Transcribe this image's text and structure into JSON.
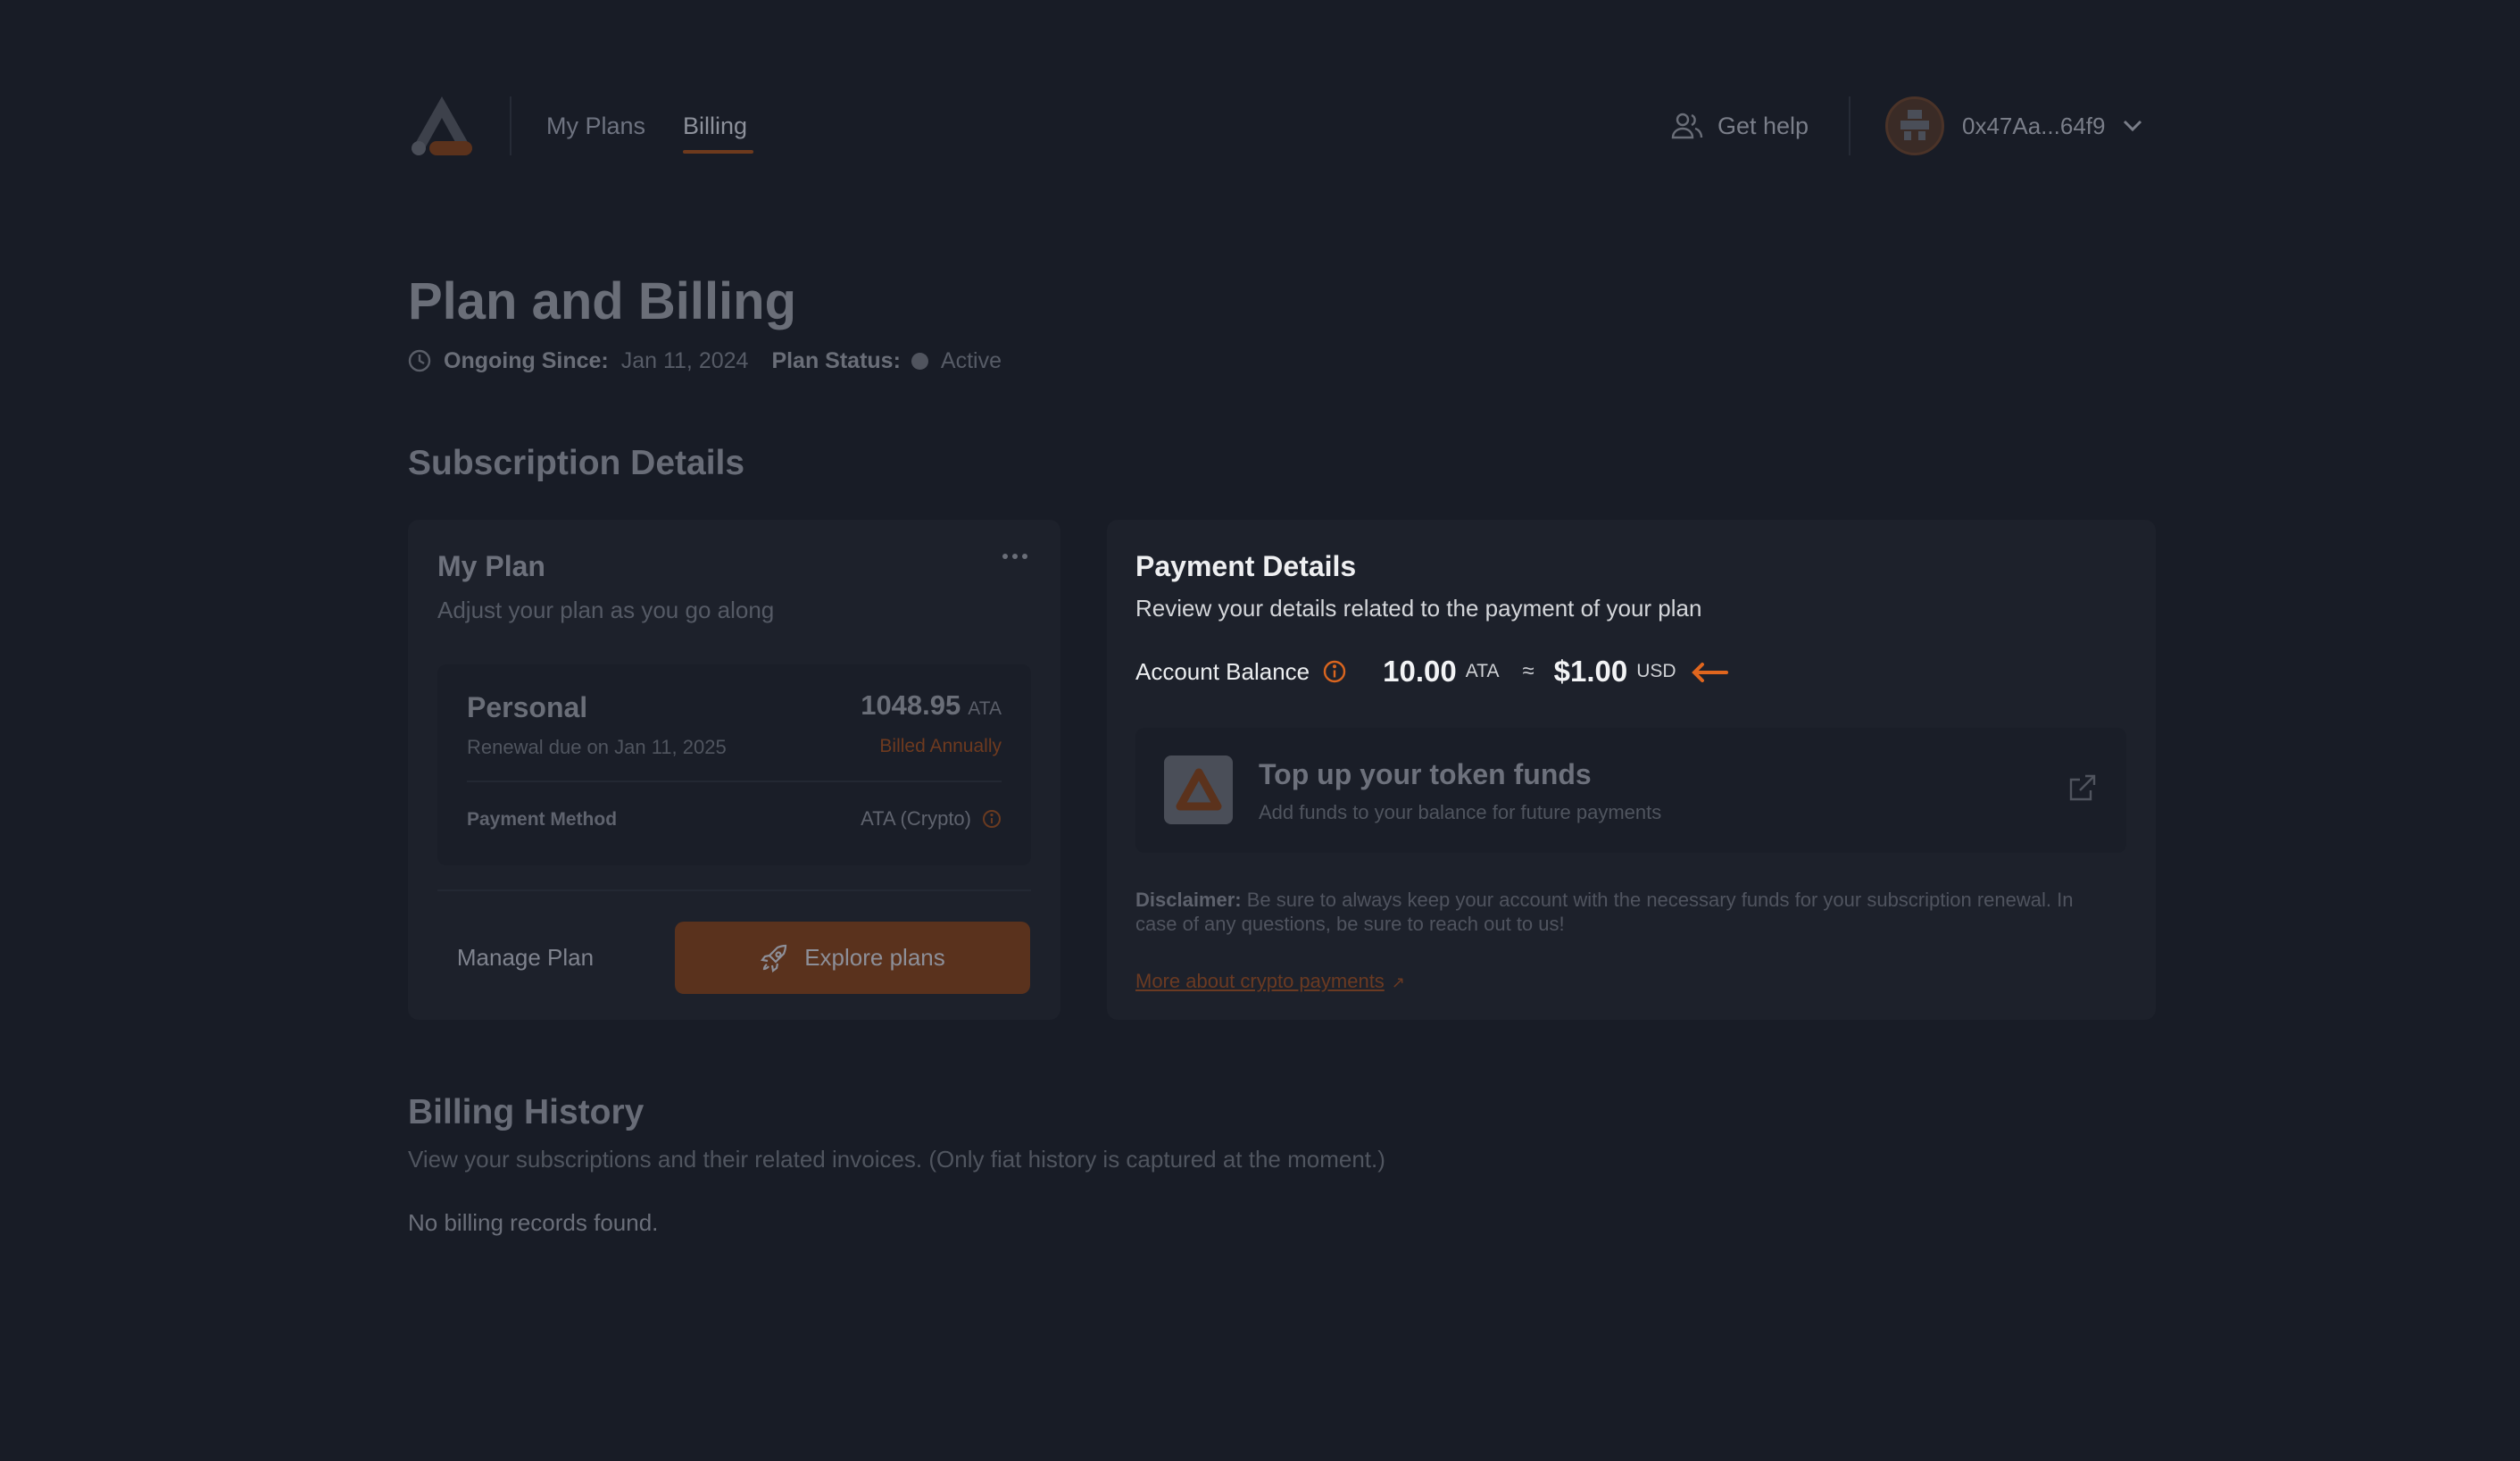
{
  "colors": {
    "background": "#181c26",
    "card": "#1d212b",
    "accent": "#d9651f",
    "accent_dim": "#5a321d"
  },
  "header": {
    "logo_icon": "brand-logo-icon",
    "nav": {
      "my_plans": "My Plans",
      "billing": "Billing",
      "active": "Billing"
    },
    "get_help": {
      "label": "Get help",
      "icon": "users-icon"
    },
    "account": {
      "address": "0x47Aa...64f9",
      "icon": "chevron-down-icon"
    }
  },
  "page": {
    "title": "Plan and Billing",
    "ongoing_since_label": "Ongoing Since:",
    "ongoing_since_value": "Jan 11, 2024",
    "plan_status_label": "Plan Status:",
    "plan_status_value": "Active"
  },
  "subscription": {
    "section_title": "Subscription Details",
    "my_plan": {
      "title": "My Plan",
      "subtitle": "Adjust your plan as you go along",
      "plan_name": "Personal",
      "renewal": "Renewal due on Jan 11, 2025",
      "price": "1048.95",
      "price_unit": "ATA",
      "billing_cycle": "Billed Annually",
      "payment_method_label": "Payment Method",
      "payment_method_value": "ATA (Crypto)",
      "manage_label": "Manage Plan",
      "explore_label": "Explore plans"
    },
    "payment_details": {
      "title": "Payment Details",
      "subtitle": "Review your details related to the payment of your plan",
      "balance_label": "Account Balance",
      "balance_amount": "10.00",
      "balance_unit": "ATA",
      "approx": "≈",
      "usd_amount": "$1.00",
      "usd_unit": "USD",
      "topup_title": "Top up your token funds",
      "topup_subtitle": "Add funds to your balance for future payments",
      "disclaimer_label": "Disclaimer:",
      "disclaimer_text": "Be sure to always keep your account with the necessary funds for your subscription renewal. In case of any questions, be sure to reach out to us!",
      "more_link": "More about crypto payments",
      "more_link_arrow": "↗"
    }
  },
  "billing_history": {
    "title": "Billing History",
    "subtitle": "View your subscriptions and their related invoices. (Only fiat history is captured at the moment.)",
    "empty": "No billing records found."
  }
}
